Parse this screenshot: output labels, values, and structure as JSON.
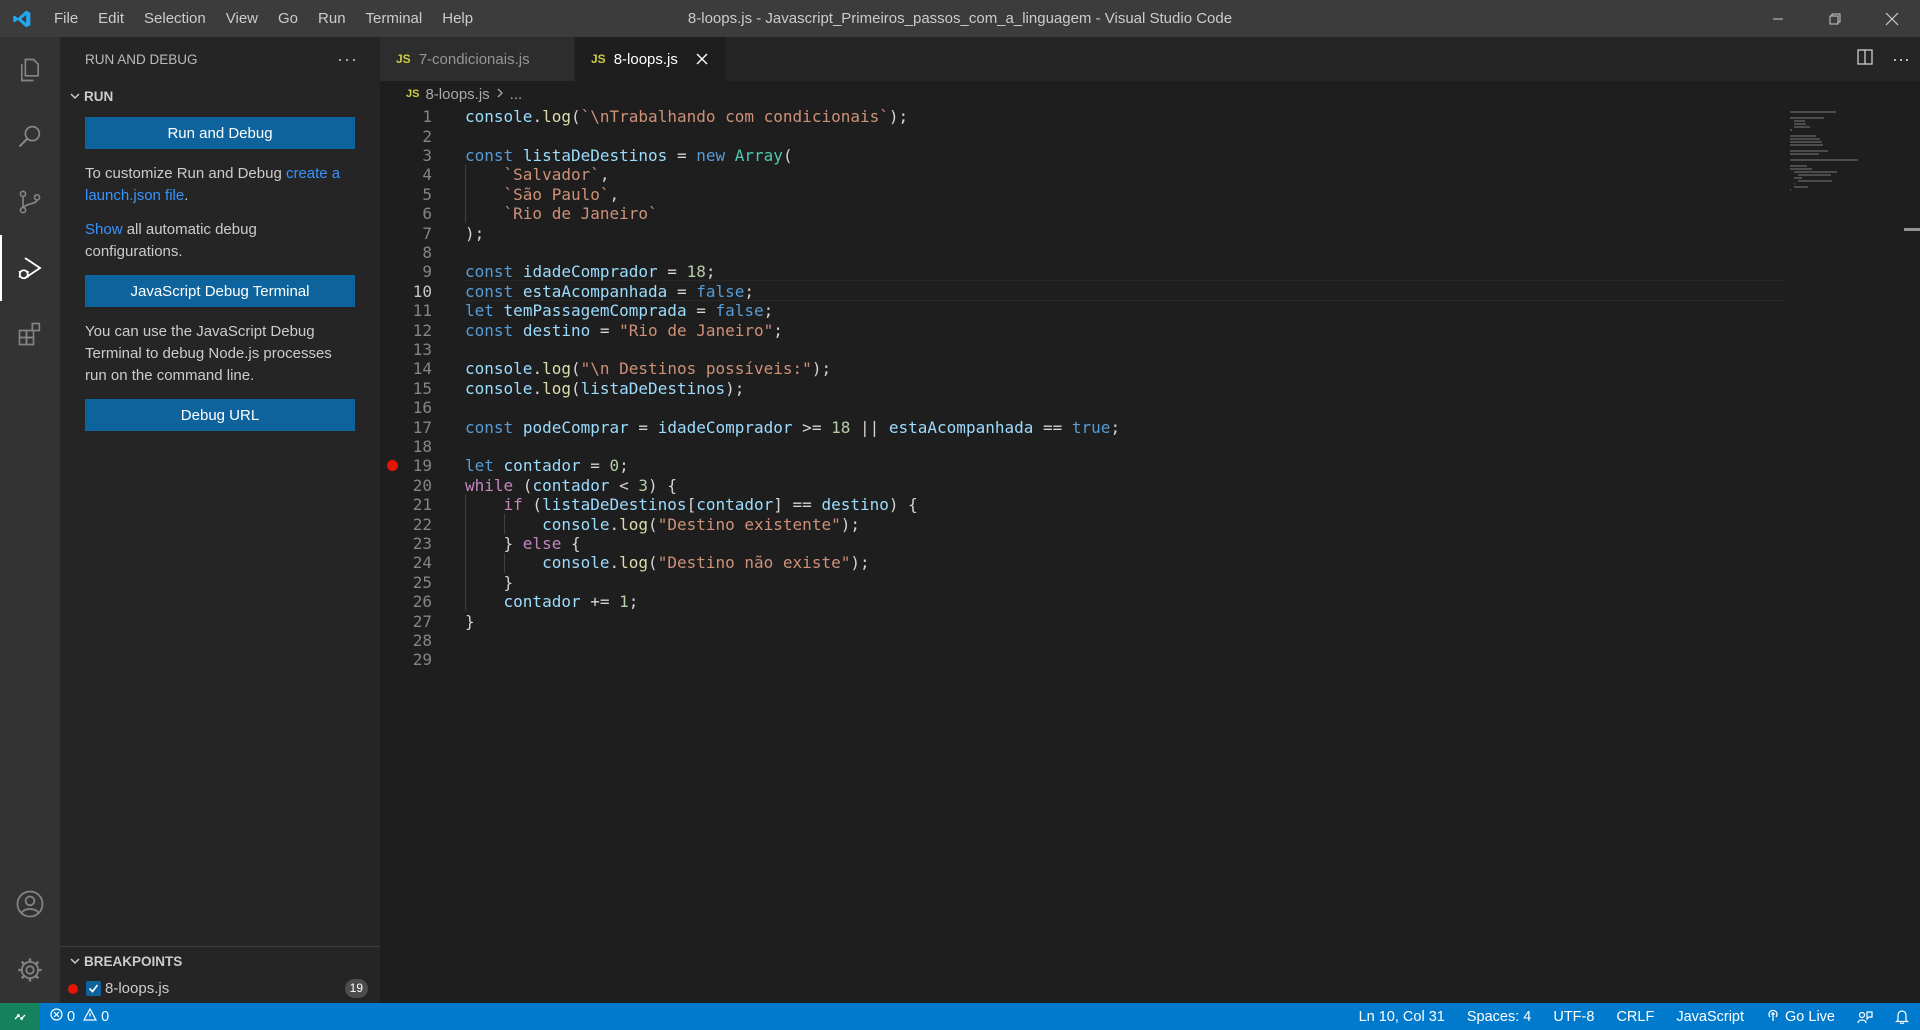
{
  "window": {
    "title": "8-loops.js - Javascript_Primeiros_passos_com_a_linguagem - Visual Studio Code",
    "menu": [
      "File",
      "Edit",
      "Selection",
      "View",
      "Go",
      "Run",
      "Terminal",
      "Help"
    ]
  },
  "sidebar": {
    "header": "RUN AND DEBUG",
    "run_section": "RUN",
    "run_debug_button": "Run and Debug",
    "customize_text_1": "To customize Run and Debug ",
    "customize_link": "create a launch.json file",
    "customize_text_2": ".",
    "show_link": "Show",
    "show_text": " all automatic debug configurations.",
    "js_terminal_button": "JavaScript Debug Terminal",
    "terminal_text": "You can use the JavaScript Debug Terminal to debug Node.js processes run on the command line.",
    "debug_url_button": "Debug URL",
    "breakpoints_title": "BREAKPOINTS",
    "breakpoint_file": "8-loops.js",
    "breakpoint_line": "19"
  },
  "tabs": [
    {
      "label": "7-condicionais.js",
      "icon": "JS"
    },
    {
      "label": "8-loops.js",
      "icon": "JS"
    }
  ],
  "breadcrumb": {
    "file": "8-loops.js",
    "rest": "..."
  },
  "editor": {
    "current_line": 10,
    "breakpoint_line": 19,
    "lines": [
      "console.log(`\\nTrabalhando com condicionais`);",
      "",
      "const listaDeDestinos = new Array(",
      "    `Salvador`,",
      "    `São Paulo`,",
      "    `Rio de Janeiro`",
      ");",
      "",
      "const idadeComprador = 18;",
      "const estaAcompanhada = false;",
      "let temPassagemComprada = false;",
      "const destino = \"Rio de Janeiro\";",
      "",
      "console.log(\"\\n Destinos possíveis:\");",
      "console.log(listaDeDestinos);",
      "",
      "const podeComprar = idadeComprador >= 18 || estaAcompanhada == true;",
      "",
      "let contador = 0;",
      "while (contador < 3) {",
      "    if (listaDeDestinos[contador] == destino) {",
      "        console.log(\"Destino existente\");",
      "    } else {",
      "        console.log(\"Destino não existe\");",
      "    }",
      "    contador += 1;",
      "}",
      "",
      ""
    ]
  },
  "status": {
    "errors": "0",
    "warnings": "0",
    "position": "Ln 10, Col 31",
    "spaces": "Spaces: 4",
    "encoding": "UTF-8",
    "eol": "CRLF",
    "language": "JavaScript",
    "live": "Go Live"
  }
}
